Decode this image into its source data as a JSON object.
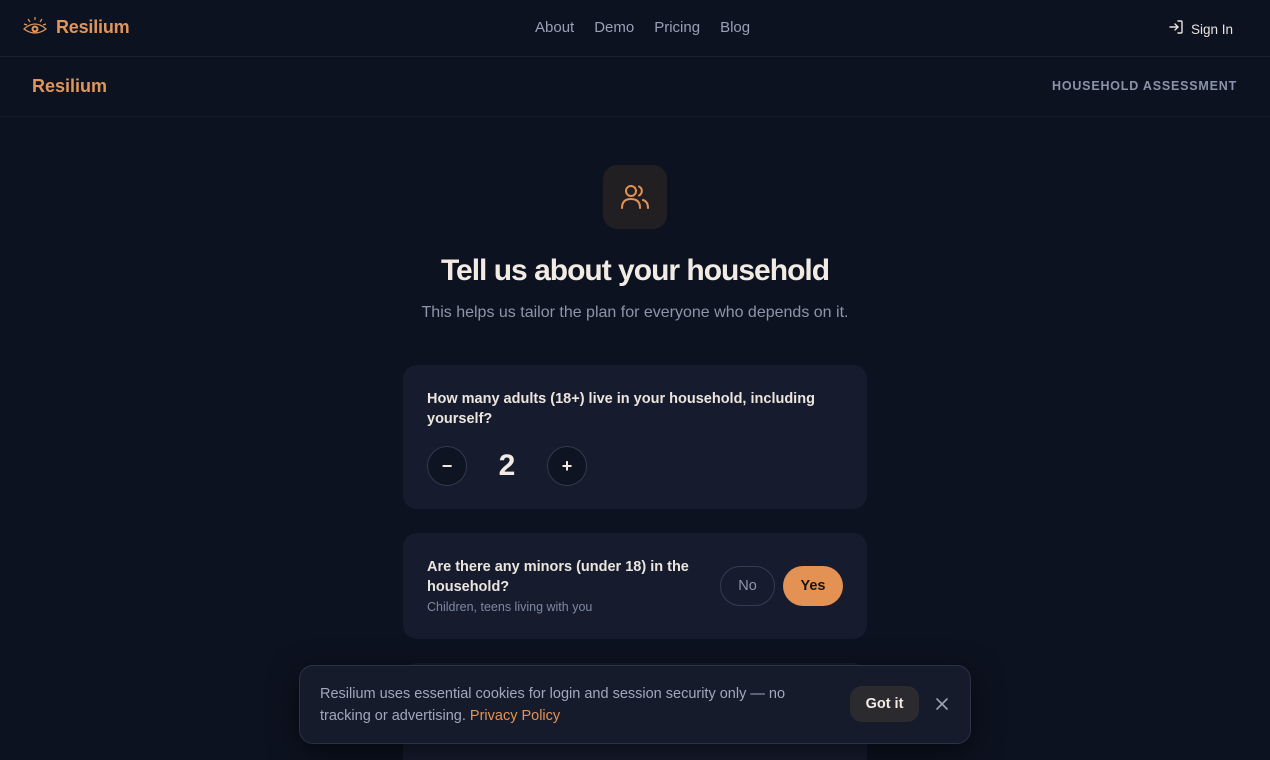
{
  "topnav": {
    "brand": "Resilium",
    "logo_icon": "eye-logo-icon",
    "links": [
      "About",
      "Demo",
      "Pricing",
      "Blog"
    ],
    "signin_label": "Sign In",
    "signin_icon": "sign-in-icon"
  },
  "subheader": {
    "title": "Resilium",
    "section": "HOUSEHOLD ASSESSMENT"
  },
  "hero": {
    "icon": "users-icon",
    "title": "Tell us about your household",
    "subtitle": "This helps us tailor the plan for everyone who depends on it."
  },
  "questions": {
    "adults": {
      "label": "How many adults (18+) live in your household, including yourself?",
      "value": "2",
      "minus": "−",
      "plus": "+"
    },
    "minors": {
      "label": "Are there any minors (under 18) in the household?",
      "hint": "Children, teens living with you",
      "no": "No",
      "yes": "Yes",
      "selected": "Yes"
    }
  },
  "cookie": {
    "message": "Resilium uses essential cookies for login and session security only — no tracking or advertising.",
    "link": "Privacy Policy",
    "button": "Got it",
    "close_icon": "close-icon"
  },
  "colors": {
    "accent": "#e39254",
    "background": "#0d1220",
    "card": "#161c2e"
  }
}
